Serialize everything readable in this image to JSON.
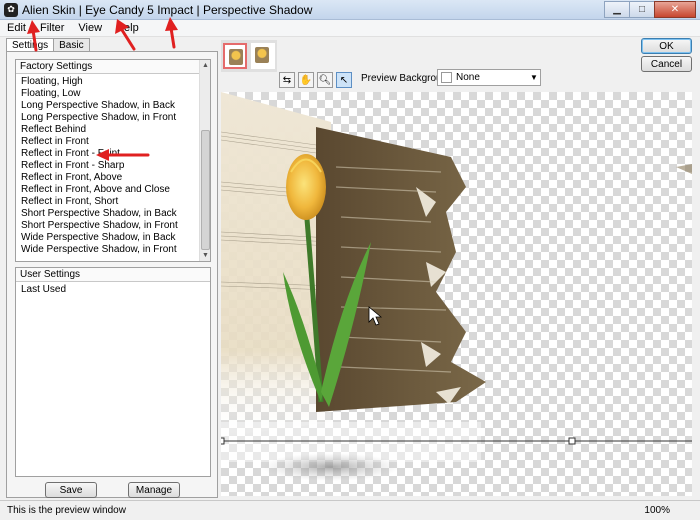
{
  "window": {
    "title": "Alien Skin | Eye Candy 5 Impact | Perspective Shadow"
  },
  "menu": [
    "Edit",
    "Filter",
    "View",
    "Help"
  ],
  "tabs": {
    "settings": "Settings",
    "basic": "Basic"
  },
  "factory": {
    "header": "Factory Settings",
    "items": [
      "Floating, High",
      "Floating, Low",
      "Long Perspective Shadow, in Back",
      "Long Perspective Shadow, in Front",
      "Reflect Behind",
      "Reflect in Front",
      "Reflect in Front - Faint",
      "Reflect in Front - Sharp",
      "Reflect in Front, Above",
      "Reflect in Front, Above and Close",
      "Reflect in Front, Short",
      "Short Perspective Shadow, in Back",
      "Short Perspective Shadow, in Front",
      "Wide Perspective Shadow, in Back",
      "Wide Perspective Shadow, in Front"
    ]
  },
  "user": {
    "header": "User Settings",
    "items": [
      "Last Used"
    ]
  },
  "buttons": {
    "save": "Save",
    "manage": "Manage",
    "ok": "OK",
    "cancel": "Cancel"
  },
  "preview": {
    "background_label": "Preview Background:",
    "background_value": "None"
  },
  "status": {
    "text": "This is the preview window",
    "zoom": "100%"
  },
  "colors": {
    "annotation_arrow": "#e02020",
    "selected_thumb_border": "#e56b6b"
  }
}
